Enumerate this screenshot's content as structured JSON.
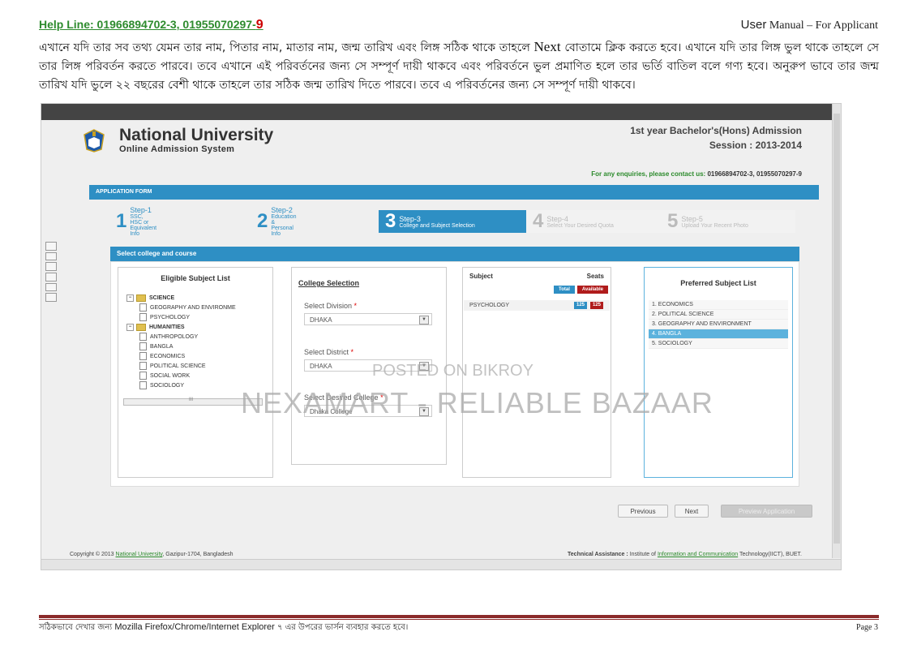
{
  "header": {
    "helpline_prefix": "Help Line: 01966894702-3, 01955070297-",
    "helpline_suffix": "9",
    "manual_a": "User",
    "manual_b": " Manual – ",
    "manual_c": "For Applicant"
  },
  "instructions": {
    "part1": "এখানে যদি তার সব তথ্য যেমন তার নাম, পিতার নাম, মাতার নাম, জন্ম তারিখ এবং লিঙ্গ  সঠিক থাকে তাহলে ",
    "next_word": "Next",
    "part2": "  বোতামে ক্লিক করতে হবে। এখানে যদি তার লিঙ্গ ভুল থাকে তাহলে সে তার লিঙ্গ পরিবর্তন করতে পারবে। তবে এখানে এই পরিবর্তনের জন্য সে সম্পূর্ণ দায়ী থাকবে এবং পরিবর্তনে ভুল প্রমাণিত হলে তার ভর্তি বাতিল বলে গণ্য হবে। অনুরুপ ভাবে তার জন্ম তারিখ যদি ভুলে ২২ বছরের বেশী থাকে তাহলে তার সঠিক জন্ম তারিখ দিতে পারবে। তবে এ পরিবর্তনের জন্য সে সম্পূর্ণ দায়ী থাকবে।"
  },
  "screenshot": {
    "site_title": "National University",
    "site_subtitle": "Online Admission System",
    "admission_title": "1st year Bachelor's(Hons) Admission",
    "session": "Session : 2013-2014",
    "enquiry_text": "For any enquiries, please contact us: ",
    "enquiry_numbers": "01966894702-3, 01955070297-9",
    "form_bar": "APPLICATION FORM",
    "steps": [
      {
        "num": "1",
        "title": "Step-1",
        "desc": "SSC, HSC or Equivalent Info"
      },
      {
        "num": "2",
        "title": "Step-2",
        "desc": "Education & Personal Info"
      },
      {
        "num": "3",
        "title": "Step-3",
        "desc": "College and Subject Selection"
      },
      {
        "num": "4",
        "title": "Step-4",
        "desc": "Select Your Desired Quota"
      },
      {
        "num": "5",
        "title": "Step-5",
        "desc": "Upload Your Recent Photo"
      }
    ],
    "section_bar": "Select college and course",
    "eligible": {
      "heading": "Eligible Subject List",
      "groups": [
        {
          "name": "SCIENCE",
          "items": [
            "GEOGRAPHY AND ENVIRONME",
            "PSYCHOLOGY"
          ]
        },
        {
          "name": "HUMANITIES",
          "items": [
            "ANTHROPOLOGY",
            "BANGLA",
            "ECONOMICS",
            "POLITICAL SCIENCE",
            "SOCIAL WORK",
            "SOCIOLOGY"
          ]
        }
      ],
      "scroll_mark": "III"
    },
    "college": {
      "heading": "College Selection",
      "division_label": "Select Division",
      "division_value": "DHAKA",
      "district_label": "Select District",
      "district_value": "DHAKA",
      "college_label": "Select Desired College",
      "college_value": "Dhaka College",
      "req": "*"
    },
    "subject": {
      "col_subject": "Subject",
      "col_seats": "Seats",
      "tag_total": "Total",
      "tag_available": "Available",
      "row_name": "PSYCHOLOGY",
      "row_total": "125",
      "row_available": "125"
    },
    "preferred": {
      "heading": "Preferred Subject List",
      "items": [
        "1. ECONOMICS",
        "2. POLITICAL SCIENCE",
        "3. GEOGRAPHY AND ENVIRONMENT",
        "4. BANGLA",
        "5. SOCIOLOGY"
      ]
    },
    "buttons": {
      "previous": "Previous",
      "next": "Next",
      "preview": "Preview Application"
    },
    "copyright_pre": "Copyright © 2013 ",
    "copyright_link": "National University",
    "copyright_post": ", Gazipur-1704, Bangladesh",
    "tech_pre": "Technical Assistance : ",
    "tech_mid": "Institute of ",
    "tech_link": "Information and Communication",
    "tech_post": " Technology(IICT), BUET.",
    "watermark_small": "POSTED ON BIKROY",
    "watermark_big": "NEXAMART - RELIABLE BAZAAR"
  },
  "footer": {
    "bn_text": "সঠিকভাবে দেখার জন্য ",
    "browsers": "Mozilla Firefox/Chrome/Internet Explorer",
    "bn_text2": " ৭ এর উপরের ভার্সন ব্যবহার করতে হবে।",
    "page": "Page 3"
  },
  "colors": {
    "accent": "#2e8fc4",
    "helpline": "#2e8b2e",
    "rule": "#8b2a2a",
    "available": "#b01c1c"
  }
}
